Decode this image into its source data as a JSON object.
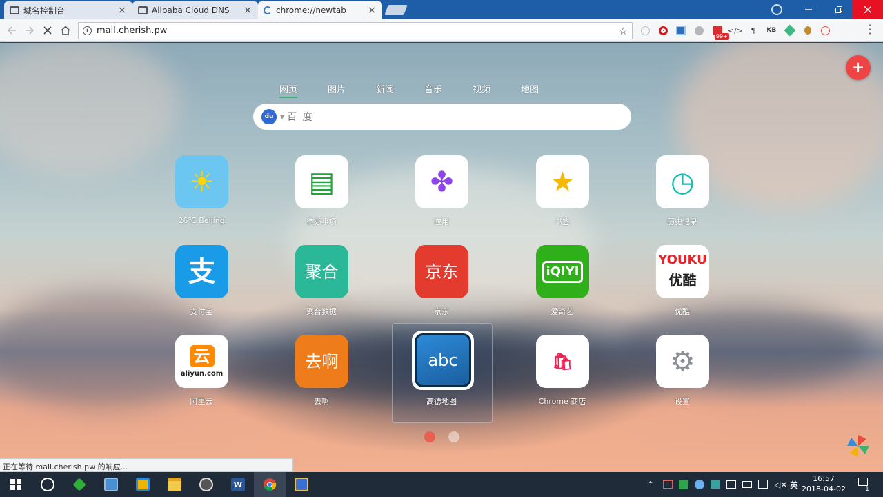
{
  "browser": {
    "tabs": [
      {
        "title": "域名控制台",
        "state": "normal"
      },
      {
        "title": "Alibaba Cloud DNS",
        "state": "normal"
      },
      {
        "title": "chrome://newtab",
        "state": "loading"
      }
    ],
    "close_glyph": "×",
    "url": "mail.cherish.pw",
    "badge_count": "99+",
    "status_text": "正在等待 mail.cherish.pw 的响应..."
  },
  "newtab": {
    "categories": [
      "网页",
      "图片",
      "新闻",
      "音乐",
      "视频",
      "地图"
    ],
    "search_placeholder": "百 度",
    "search_engine_icon": "du",
    "add_glyph": "+",
    "tiles": [
      {
        "label": "26℃ Beijing",
        "icon": "sun-icon",
        "bg": "#6cc6f2",
        "glyph": "☀",
        "glyph_color": "#ffd400"
      },
      {
        "label": "待办事项",
        "icon": "todo-icon",
        "bg": "#ffffff",
        "glyph": "▤",
        "glyph_color": "#1fa53a"
      },
      {
        "label": "应用",
        "icon": "apps-icon",
        "bg": "#ffffff",
        "glyph": "✤",
        "glyph_color": "#8e44e8"
      },
      {
        "label": "书签",
        "icon": "star-icon",
        "bg": "#ffffff",
        "glyph": "★",
        "glyph_color": "#f5b800"
      },
      {
        "label": "历史记录",
        "icon": "clock-icon",
        "bg": "#ffffff",
        "glyph": "◷",
        "glyph_color": "#17b8b0"
      },
      {
        "label": "支付宝",
        "icon": "alipay-icon",
        "bg": "#1a9be8",
        "glyph": "支",
        "glyph_color": "#ffffff"
      },
      {
        "label": "聚合数据",
        "icon": "juhe-icon",
        "bg": "#2bb898",
        "glyph": "聚合",
        "glyph_color": "#ffffff"
      },
      {
        "label": "京东",
        "icon": "jd-icon",
        "bg": "#e33b2e",
        "glyph": "京东",
        "glyph_color": "#ffffff"
      },
      {
        "label": "爱奇艺",
        "icon": "iqiyi-icon",
        "bg": "#2fb01a",
        "glyph": "iQIYI",
        "glyph_color": "#ffffff"
      },
      {
        "label": "优酷",
        "icon": "youku-icon",
        "bg": "#ffffff",
        "glyph": "YOUKU",
        "glyph2": "优酷",
        "glyph_color": "#e8212a"
      },
      {
        "label": "阿里云",
        "icon": "aliyun-icon",
        "bg": "#ffffff",
        "glyph": "云",
        "glyph2": "aliyun.com",
        "glyph_color": "#ff8a00"
      },
      {
        "label": "去啊",
        "icon": "quna-icon",
        "bg": "#ef7c1a",
        "glyph": "去啊",
        "glyph_color": "#ffffff"
      },
      {
        "label": "高德地图",
        "icon": "abc-translate-icon",
        "bg": "#ffffff",
        "glyph": "abc",
        "glyph_color": "#ffffff"
      },
      {
        "label": "Chrome 商店",
        "icon": "shopping-bag-icon",
        "bg": "#ffffff",
        "glyph": "🛍",
        "glyph_color": "#ee2153"
      },
      {
        "label": "设置",
        "icon": "gear-icon",
        "bg": "#ffffff",
        "glyph": "⚙",
        "glyph_color": "#8a8f95"
      }
    ],
    "pager": {
      "pages": 2,
      "current": 1
    }
  },
  "taskbar": {
    "time": "16:57",
    "date": "2018-04-02",
    "ime": "英",
    "notif_count": "1"
  },
  "colors": {
    "titlebar": "#1e5da8",
    "accent_green": "#3cb371",
    "add_button": "#ef4444"
  }
}
